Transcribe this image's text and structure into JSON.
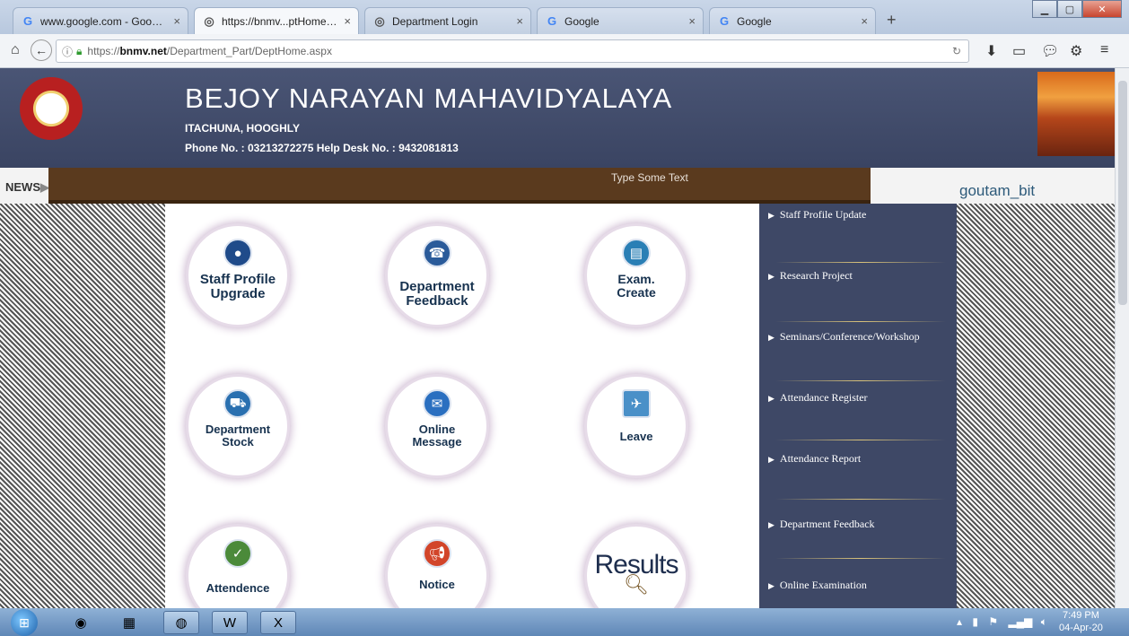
{
  "browser": {
    "tabs": [
      {
        "title": "www.google.com - Google...",
        "icon": "google-icon",
        "active": false
      },
      {
        "title": "https://bnmv...ptHome.aspx",
        "icon": "college-icon",
        "active": true
      },
      {
        "title": "Department Login",
        "icon": "college-icon",
        "active": false
      },
      {
        "title": "Google",
        "icon": "google-icon",
        "active": false
      },
      {
        "title": "Google",
        "icon": "google-icon",
        "active": false
      }
    ],
    "new_tab": "+",
    "url_prefix": "https://",
    "url_host": "bnmv.net",
    "url_path": "/Department_Part/DeptHome.aspx"
  },
  "site": {
    "title": "BEJOY NARAYAN MAHAVIDYALAYA",
    "address": "ITACHUNA, HOOGHLY",
    "phone": "Phone No. : 03213272275    Help Desk No. : 9432081813"
  },
  "news": {
    "label": "NEWS",
    "text": "Type Some Text",
    "username": "goutam_bit"
  },
  "tiles": [
    {
      "label_1": "Staff Profile",
      "label_2": "Upgrade",
      "icon": "person-icon",
      "color": "#1f4b8a"
    },
    {
      "label_1": "Department",
      "label_2": "Feedback",
      "icon": "feedback-icon",
      "color": "#2a5b9a"
    },
    {
      "label_1": "Exam.",
      "label_2": "Create",
      "icon": "document-icon",
      "color": "#2a7fb5"
    },
    {
      "label_1": "Department",
      "label_2": "Stock",
      "icon": "basket-icon",
      "color": "#2a70b0"
    },
    {
      "label_1": "Online",
      "label_2": "Message",
      "icon": "mail-icon",
      "color": "#2a6fc0"
    },
    {
      "label_1": "Leave",
      "label_2": "",
      "icon": "leave-calendar-icon",
      "color": "#4a90c8"
    },
    {
      "label_1": "Attendence",
      "label_2": "",
      "icon": "attendance-icon",
      "color": "#4b8a3a"
    },
    {
      "label_1": "Notice",
      "label_2": "",
      "icon": "megaphone-icon",
      "color": "#d2452a"
    },
    {
      "label_1": "Results",
      "label_2": "",
      "icon": "magnifier-icon",
      "color": "#1e2e4e"
    }
  ],
  "side_menu": [
    "Staff Profile Update",
    "Research Project",
    "Seminars/Conference/Workshop",
    "Attendance Register",
    "Attendance Report",
    "Department Feedback",
    "Online Examination"
  ],
  "taskbar": {
    "time": "7:49 PM",
    "date": "04-Apr-20"
  },
  "colors": {
    "header_bg": "#4a5575",
    "news_strip": "#5a3a1e",
    "side_menu_bg": "#3e4866",
    "tile_text": "#17324f"
  }
}
